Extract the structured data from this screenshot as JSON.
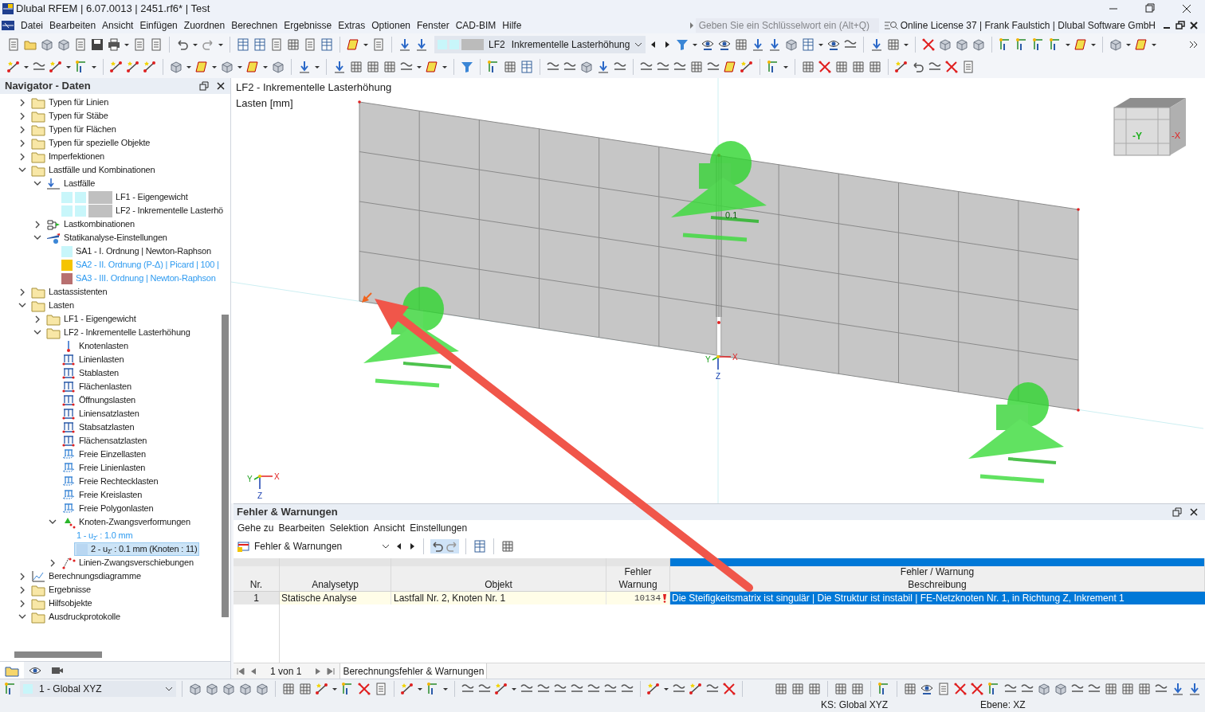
{
  "window": {
    "title": "Dlubal RFEM | 6.07.0013 | 2451.rf6* | Test"
  },
  "menu": [
    "Datei",
    "Bearbeiten",
    "Ansicht",
    "Einfügen",
    "Zuordnen",
    "Berechnen",
    "Ergebnisse",
    "Extras",
    "Optionen",
    "Fenster",
    "CAD-BIM",
    "Hilfe"
  ],
  "search": {
    "placeholder": "Geben Sie ein Schlüsselwort ein (Alt+Q)"
  },
  "license": "Online License 37 | Frank Faulstich | Dlubal Software GmbH",
  "load_case_selector": {
    "code": "LF2",
    "name": "Inkrementelle Lasterhöhung"
  },
  "navigator": {
    "title": "Navigator - Daten",
    "tree": [
      {
        "label": "Typen für Linien",
        "kind": "folder",
        "expanded": false,
        "selected": false
      },
      {
        "label": "Typen für Stäbe",
        "kind": "folder",
        "expanded": false,
        "selected": false
      },
      {
        "label": "Typen für Flächen",
        "kind": "folder",
        "expanded": false,
        "selected": false
      },
      {
        "label": "Typen für spezielle Objekte",
        "kind": "folder",
        "expanded": false,
        "selected": false
      },
      {
        "label": "Imperfektionen",
        "kind": "folder",
        "expanded": false,
        "selected": false
      },
      {
        "label": "Lastfälle und Kombinationen",
        "kind": "folder",
        "expanded": true,
        "selected": false,
        "children": [
          {
            "label": "Lastfälle",
            "kind": "loadcases",
            "expanded": true,
            "selected": false,
            "children": [
              {
                "label": "LF1 - Eigengewicht",
                "kind": "loadcase",
                "selected": false
              },
              {
                "label": "LF2 - Inkrementelle Lasterhö",
                "kind": "loadcase",
                "selected": false
              }
            ]
          },
          {
            "label": "Lastkombinationen",
            "kind": "combination",
            "expanded": false,
            "selected": false
          },
          {
            "label": "Statikanalyse-Einstellungen",
            "kind": "analysis",
            "expanded": true,
            "selected": false,
            "children": [
              {
                "label": "SA1 - I. Ordnung | Newton-Raphson",
                "kind": "swatch",
                "color": "#c8f6fa",
                "highlighted": false,
                "selected": false
              },
              {
                "label": "SA2 - II. Ordnung (P-Δ) | Picard | 100 |",
                "kind": "swatch",
                "color": "#f5c400",
                "highlighted": true,
                "selected": false
              },
              {
                "label": "SA3 - III. Ordnung | Newton-Raphson",
                "kind": "swatch",
                "color": "#b87070",
                "highlighted": true,
                "selected": false
              }
            ]
          }
        ]
      },
      {
        "label": "Lastassistenten",
        "kind": "folder",
        "expanded": false,
        "selected": false
      },
      {
        "label": "Lasten",
        "kind": "folder",
        "expanded": true,
        "selected": false,
        "children": [
          {
            "label": "LF1 - Eigengewicht",
            "kind": "folder",
            "expanded": false,
            "selected": false
          },
          {
            "label": "LF2 - Inkrementelle Lasterhöhung",
            "kind": "folder",
            "expanded": true,
            "selected": false,
            "children": [
              {
                "label": "Knotenlasten",
                "kind": "nodal",
                "selected": false
              },
              {
                "label": "Linienlasten",
                "kind": "load",
                "selected": false
              },
              {
                "label": "Stablasten",
                "kind": "load",
                "selected": false
              },
              {
                "label": "Flächenlasten",
                "kind": "load",
                "selected": false
              },
              {
                "label": "Öffnungslasten",
                "kind": "load",
                "selected": false
              },
              {
                "label": "Liniensatzlasten",
                "kind": "load",
                "selected": false
              },
              {
                "label": "Stabsatzlasten",
                "kind": "load",
                "selected": false
              },
              {
                "label": "Flächensatzlasten",
                "kind": "load",
                "selected": false
              },
              {
                "label": "Freie Einzellasten",
                "kind": "free",
                "selected": false
              },
              {
                "label": "Freie Linienlasten",
                "kind": "free",
                "selected": false
              },
              {
                "label": "Freie Rechtecklasten",
                "kind": "free",
                "selected": false
              },
              {
                "label": "Freie Kreislasten",
                "kind": "free",
                "selected": false
              },
              {
                "label": "Freie Polygonlasten",
                "kind": "free",
                "selected": false
              },
              {
                "label": "Knoten-Zwangsverformungen",
                "kind": "support",
                "expanded": true,
                "selected": false,
                "children": [
                  {
                    "label": "1 - u$_{z'}$ : 1.0 mm",
                    "kind": "none",
                    "highlighted": true,
                    "selected": false
                  },
                  {
                    "label": "2 - u$_{z'}$ : 0.1 mm (Knoten : 11)",
                    "kind": "swatch",
                    "color": "#b9d7f2",
                    "highlighted": false,
                    "selected": true
                  }
                ]
              },
              {
                "label": "Linien-Zwangsverschiebungen",
                "kind": "linesupport",
                "expanded": false,
                "selected": false
              }
            ]
          }
        ]
      },
      {
        "label": "Berechnungsdiagramme",
        "kind": "diagram",
        "expanded": false,
        "selected": false
      },
      {
        "label": "Ergebnisse",
        "kind": "folder",
        "expanded": false,
        "selected": false
      },
      {
        "label": "Hilfsobjekte",
        "kind": "folder",
        "expanded": false,
        "selected": false
      },
      {
        "label": "Ausdruckprotokolle",
        "kind": "folder",
        "expanded": true,
        "selected": false
      }
    ]
  },
  "viewport": {
    "title": "LF2 - Inkrementelle Lasterhöhung",
    "subtitle": "Lasten [mm]",
    "value_label": "0.1",
    "cube_labels": [
      "-Y",
      "-X"
    ],
    "origin_axes": [
      "Y",
      "X",
      "Z"
    ],
    "corner_axes": [
      "Y",
      "X",
      "Z"
    ]
  },
  "panel": {
    "title": "Fehler & Warnungen",
    "menu": [
      "Gehe zu",
      "Bearbeiten",
      "Selektion",
      "Ansicht",
      "Einstellungen"
    ],
    "dropdown": "Fehler & Warnungen",
    "columns": [
      {
        "lines": [
          "Nr."
        ]
      },
      {
        "lines": [
          "Analysetyp"
        ]
      },
      {
        "lines": [
          "Objekt"
        ]
      },
      {
        "lines": [
          "Fehler",
          "Warnung"
        ]
      },
      {
        "lines": [
          "Fehler / Warnung",
          "Beschreibung"
        ]
      }
    ],
    "rows": [
      {
        "nr": "1",
        "analysis": "Statische Analyse",
        "object": "Lastfall Nr. 2, Knoten Nr. 1",
        "code": "10134",
        "description": "Die Steifigkeitsmatrix ist singulär |  Die Struktur ist instabil | FE-Netzknoten Nr. 1, in Richtung Z, Inkrement 1",
        "selected": true
      }
    ],
    "pager": "1 von 1",
    "tab": "Berechnungsfehler & Warnungen"
  },
  "coordinate_system": "1 - Global XYZ",
  "status": [
    "KS: Global XYZ",
    "Ebene: XZ"
  ]
}
